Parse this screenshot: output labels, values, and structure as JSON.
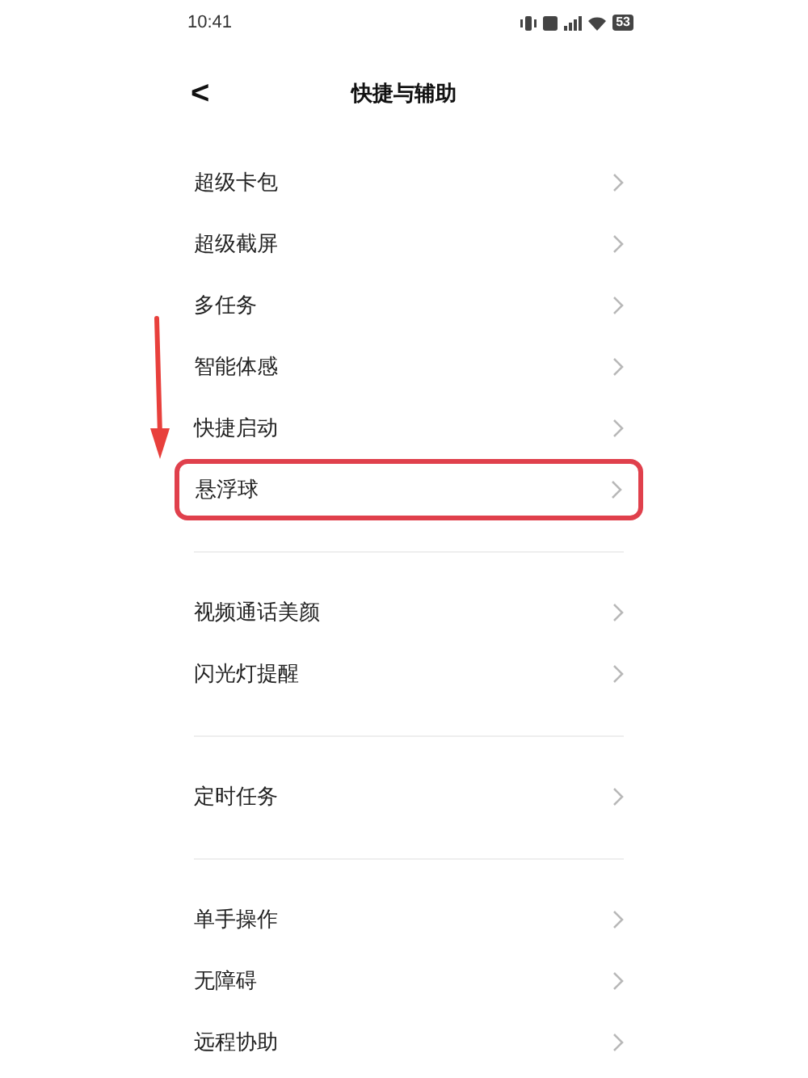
{
  "status_bar": {
    "time": "10:41",
    "battery": "53"
  },
  "header": {
    "back": "<",
    "title": "快捷与辅助"
  },
  "groups": [
    [
      {
        "label": "超级卡包",
        "highlighted": false
      },
      {
        "label": "超级截屏",
        "highlighted": false
      },
      {
        "label": "多任务",
        "highlighted": false
      },
      {
        "label": "智能体感",
        "highlighted": false
      },
      {
        "label": "快捷启动",
        "highlighted": false
      },
      {
        "label": "悬浮球",
        "highlighted": true
      }
    ],
    [
      {
        "label": "视频通话美颜",
        "highlighted": false
      },
      {
        "label": "闪光灯提醒",
        "highlighted": false
      }
    ],
    [
      {
        "label": "定时任务",
        "highlighted": false
      }
    ],
    [
      {
        "label": "单手操作",
        "highlighted": false
      },
      {
        "label": "无障碍",
        "highlighted": false
      },
      {
        "label": "远程协助",
        "highlighted": false
      }
    ]
  ]
}
